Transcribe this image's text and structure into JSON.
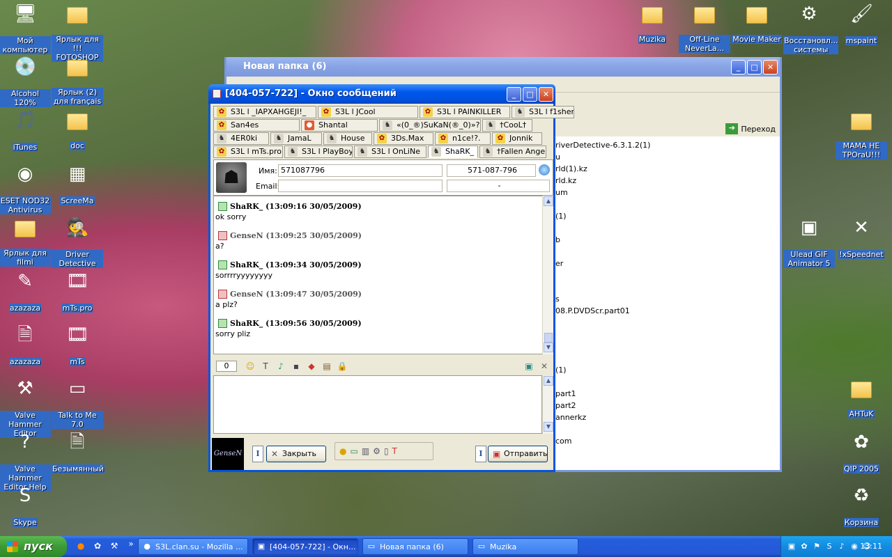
{
  "desktop_icons": [
    {
      "label": "Мой компьютер",
      "glyph": "🖥",
      "selected": true
    },
    {
      "label": "Ярлык для !!! FOTOSHOP",
      "glyph": "folder",
      "selected": true
    },
    {
      "label": "Alcohol 120%",
      "glyph": "💿",
      "selected": true
    },
    {
      "label": "Ярлык (2) для français",
      "glyph": "folder",
      "selected": true
    },
    {
      "label": "iTunes",
      "glyph": "🎵",
      "selected": true
    },
    {
      "label": "doc",
      "glyph": "folder",
      "selected": true
    },
    {
      "label": "ESET NOD32 Antivirus",
      "glyph": "◉",
      "selected": true
    },
    {
      "label": "ScreeMa",
      "glyph": "▦",
      "selected": true
    },
    {
      "label": "Ярлык для filmi",
      "glyph": "folder",
      "selected": true
    },
    {
      "label": "Driver Detective",
      "glyph": "🕵",
      "selected": true
    },
    {
      "label": "azazaza",
      "glyph": "✎",
      "selected": true
    },
    {
      "label": "mTs.pro",
      "glyph": "🎞",
      "selected": true
    },
    {
      "label": "azazaza",
      "glyph": "🗎",
      "selected": true
    },
    {
      "label": "mTs",
      "glyph": "🎞",
      "selected": true
    },
    {
      "label": "Valve Hammer Editor",
      "glyph": "⚒",
      "selected": true
    },
    {
      "label": "Talk to Me 7.0",
      "glyph": "▭",
      "selected": true
    },
    {
      "label": "Valve Hammer Editor Help",
      "glyph": "?",
      "selected": true
    },
    {
      "label": "Безымянный",
      "glyph": "🗎",
      "selected": true
    },
    {
      "label": "Skype",
      "glyph": "S",
      "selected": true
    },
    {
      "label": "Muzika",
      "glyph": "folder",
      "selected": true
    },
    {
      "label": "Off-Line NeverLa...",
      "glyph": "folder",
      "selected": true
    },
    {
      "label": "Movie Maker",
      "glyph": "folder",
      "selected": true
    },
    {
      "label": "Восстановл... системы",
      "glyph": "⚙",
      "selected": true
    },
    {
      "label": "mspaint",
      "glyph": "🖌",
      "selected": true
    },
    {
      "label": "MAMA HE TPOraU!!!",
      "glyph": "folder",
      "selected": true
    },
    {
      "label": "Ulead GIF Animator 5",
      "glyph": "▣",
      "selected": true
    },
    {
      "label": "!xSpeednet",
      "glyph": "✕",
      "selected": true
    },
    {
      "label": "AHTuK",
      "glyph": "folder",
      "selected": true
    },
    {
      "label": "QIP 2005",
      "glyph": "✿",
      "selected": true
    },
    {
      "label": "Корзина",
      "glyph": "♻",
      "selected": true
    }
  ],
  "explorer": {
    "title": "Новая папка (6)",
    "go_label": "Переход",
    "files": [
      "riverDetective-6.3.1.2(1)",
      "u",
      "rld(1).kz",
      "rld.kz",
      "um",
      "(1)",
      "b",
      "er",
      "s",
      "08.P.DVDScr.part01",
      "(1)",
      "part1",
      "part2",
      "annerkz",
      "com"
    ]
  },
  "chat": {
    "title": "[404-057-722] - Окно сообщений",
    "tabs_row1": [
      {
        "label": "S3L l _IAPXAHGEJI!_",
        "icon": "qp"
      },
      {
        "label": "S3L l JCool",
        "icon": "qp"
      },
      {
        "label": "S3L l PAINKILLER",
        "icon": "qp"
      },
      {
        "label": "S3L l f1sher",
        "icon": "cs"
      }
    ],
    "tabs_row2": [
      {
        "label": "San4es",
        "icon": "qp"
      },
      {
        "label": "Shantal",
        "icon": "red"
      },
      {
        "label": "«(0_®)SuKaN(®_0)»?",
        "icon": "cs"
      },
      {
        "label": "†CooL†",
        "icon": "cs"
      }
    ],
    "tabs_row3": [
      {
        "label": "4ER0ki",
        "icon": "cs"
      },
      {
        "label": "JamaL",
        "icon": "cs"
      },
      {
        "label": "House",
        "icon": "cs"
      },
      {
        "label": "3Ds.Max",
        "icon": "qp"
      },
      {
        "label": "n1ce!?.",
        "icon": "qp"
      },
      {
        "label": "Jonnik",
        "icon": "qp"
      }
    ],
    "tabs_row4": [
      {
        "label": "S3L l mTs.pro",
        "icon": "qp"
      },
      {
        "label": "S3L l PlayBoy",
        "icon": "cs"
      },
      {
        "label": "S3L l OnLiNe",
        "icon": "cs"
      },
      {
        "label": "ShaRK_",
        "icon": "cs",
        "active": true
      },
      {
        "label": "†Fallen Angel†",
        "icon": "cs"
      }
    ],
    "name_label": "Имя:",
    "name_value": "571087796",
    "uin_value": "571-087-796",
    "email_label": "Email:",
    "email_value": "",
    "email_right": "-",
    "messages": [
      {
        "header": "ShaRK_ (13:09:16 30/05/2009)",
        "text": "ok sorry",
        "incoming": false
      },
      {
        "header": "GenseN (13:09:25 30/05/2009)",
        "text": "a?",
        "incoming": true
      },
      {
        "header": "ShaRK_ (13:09:34 30/05/2009)",
        "text": "sorrrryyyyyyyy",
        "incoming": false
      },
      {
        "header": "GenseN (13:09:47 30/05/2009)",
        "text": "a plz?",
        "incoming": true
      },
      {
        "header": "ShaRK_ (13:09:56 30/05/2009)",
        "text": "sorry pliz",
        "incoming": false
      }
    ],
    "char_count": "0",
    "close_label": "Закрыть",
    "send_label": "Отправить",
    "logo_text": "GenseN",
    "i_label": "I"
  },
  "taskbar": {
    "start_label": "пуск",
    "tasks": [
      {
        "label": "S3L.clan.su - Mozilla ...",
        "active": false
      },
      {
        "label": "[404-057-722] - Окн...",
        "active": true
      },
      {
        "label": "Новая папка (6)",
        "active": false
      },
      {
        "label": "Muzika",
        "active": false
      }
    ],
    "overflow": "»",
    "clock": "13:11"
  }
}
